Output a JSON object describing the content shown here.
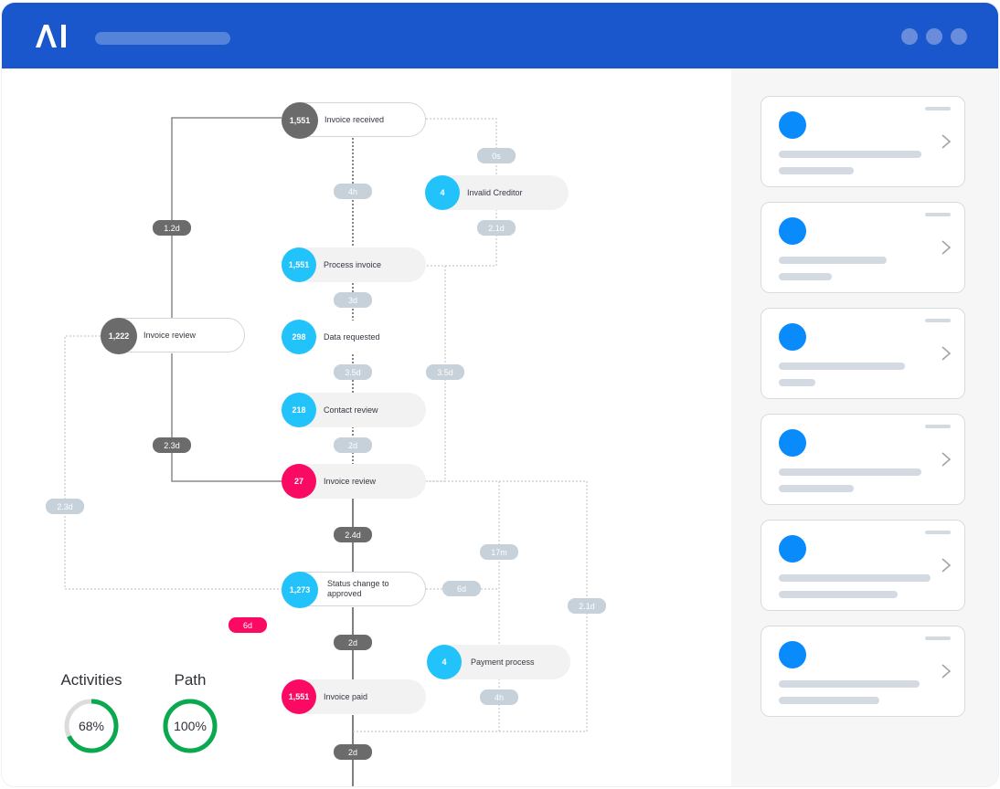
{
  "app": {
    "logo_text": "AI",
    "logo_icon": "ai-logo-icon",
    "window_controls": [
      "dot",
      "dot",
      "dot"
    ]
  },
  "colors": {
    "titlebar": "#1a56cc",
    "node_gray": "#6b6b6b",
    "node_blue": "#22c3fb",
    "node_pink": "#fb0a63",
    "tag_light": "#c6d1da",
    "progress_green": "#0aa84f",
    "card_avatar": "#0a8bfb"
  },
  "process_map": {
    "nodes": [
      {
        "id": "invoice-received",
        "count": "1,551",
        "label": "Invoice received",
        "color": "gray",
        "style": "outline"
      },
      {
        "id": "invalid-creditor",
        "count": "4",
        "label": "Invalid Creditor",
        "color": "blue",
        "style": "fill"
      },
      {
        "id": "process-invoice",
        "count": "1,551",
        "label": "Process invoice",
        "color": "blue",
        "style": "fill"
      },
      {
        "id": "invoice-review-main",
        "count": "1,222",
        "label": "Invoice review",
        "color": "gray",
        "style": "outline"
      },
      {
        "id": "data-requested",
        "count": "298",
        "label": "Data requested",
        "color": "blue",
        "style": "plain"
      },
      {
        "id": "contact-review",
        "count": "218",
        "label": "Contact review",
        "color": "blue",
        "style": "fill"
      },
      {
        "id": "invoice-review-alt",
        "count": "27",
        "label": "Invoice review",
        "color": "pink",
        "style": "fill"
      },
      {
        "id": "status-change",
        "count": "1,273",
        "label": "Status change to approved",
        "color": "blue",
        "style": "outline"
      },
      {
        "id": "payment-process",
        "count": "4",
        "label": "Payment process",
        "color": "blue",
        "style": "fill"
      },
      {
        "id": "invoice-paid",
        "count": "1,551",
        "label": "Invoice paid",
        "color": "pink",
        "style": "fill"
      }
    ],
    "durations": [
      {
        "id": "d-1-2d",
        "text": "1.2d",
        "kind": "dark"
      },
      {
        "id": "d-0s",
        "text": "0s",
        "kind": "light"
      },
      {
        "id": "d-4h-top",
        "text": "4h",
        "kind": "light"
      },
      {
        "id": "d-2-1d-top",
        "text": "2.1d",
        "kind": "light"
      },
      {
        "id": "d-3d",
        "text": "3d",
        "kind": "light"
      },
      {
        "id": "d-3-5d-center",
        "text": "3.5d",
        "kind": "light"
      },
      {
        "id": "d-3-5d-right",
        "text": "3.5d",
        "kind": "light"
      },
      {
        "id": "d-2-3d-dark",
        "text": "2.3d",
        "kind": "dark"
      },
      {
        "id": "d-2d-light",
        "text": "2d",
        "kind": "light"
      },
      {
        "id": "d-2-3d-light",
        "text": "2.3d",
        "kind": "light"
      },
      {
        "id": "d-2-4d",
        "text": "2.4d",
        "kind": "dark"
      },
      {
        "id": "d-17m",
        "text": "17m",
        "kind": "light"
      },
      {
        "id": "d-6d-light",
        "text": "6d",
        "kind": "light"
      },
      {
        "id": "d-2-1d-right",
        "text": "2.1d",
        "kind": "light"
      },
      {
        "id": "d-6d-pink",
        "text": "6d",
        "kind": "pink"
      },
      {
        "id": "d-2d-dark-mid",
        "text": "2d",
        "kind": "dark"
      },
      {
        "id": "d-4h-bottom",
        "text": "4h",
        "kind": "light"
      },
      {
        "id": "d-2d-dark-bottom",
        "text": "2d",
        "kind": "dark"
      }
    ]
  },
  "metrics": [
    {
      "title": "Activities",
      "value_text": "68%",
      "fraction": 0.68
    },
    {
      "title": "Path",
      "value_text": "100%",
      "fraction": 1.0
    }
  ],
  "sidebar": {
    "cards": [
      {
        "chevron_icon": "chevron-right-icon",
        "line1_fraction": 0.78,
        "line2_fraction": 0.41
      },
      {
        "chevron_icon": "chevron-right-icon",
        "line1_fraction": 0.59,
        "line2_fraction": 0.29
      },
      {
        "chevron_icon": "chevron-right-icon",
        "line1_fraction": 0.69,
        "line2_fraction": 0.2
      },
      {
        "chevron_icon": "chevron-right-icon",
        "line1_fraction": 0.78,
        "line2_fraction": 0.41
      },
      {
        "chevron_icon": "chevron-right-icon",
        "line1_fraction": 0.83,
        "line2_fraction": 0.65
      },
      {
        "chevron_icon": "chevron-right-icon",
        "line1_fraction": 0.77,
        "line2_fraction": 0.55
      }
    ]
  }
}
